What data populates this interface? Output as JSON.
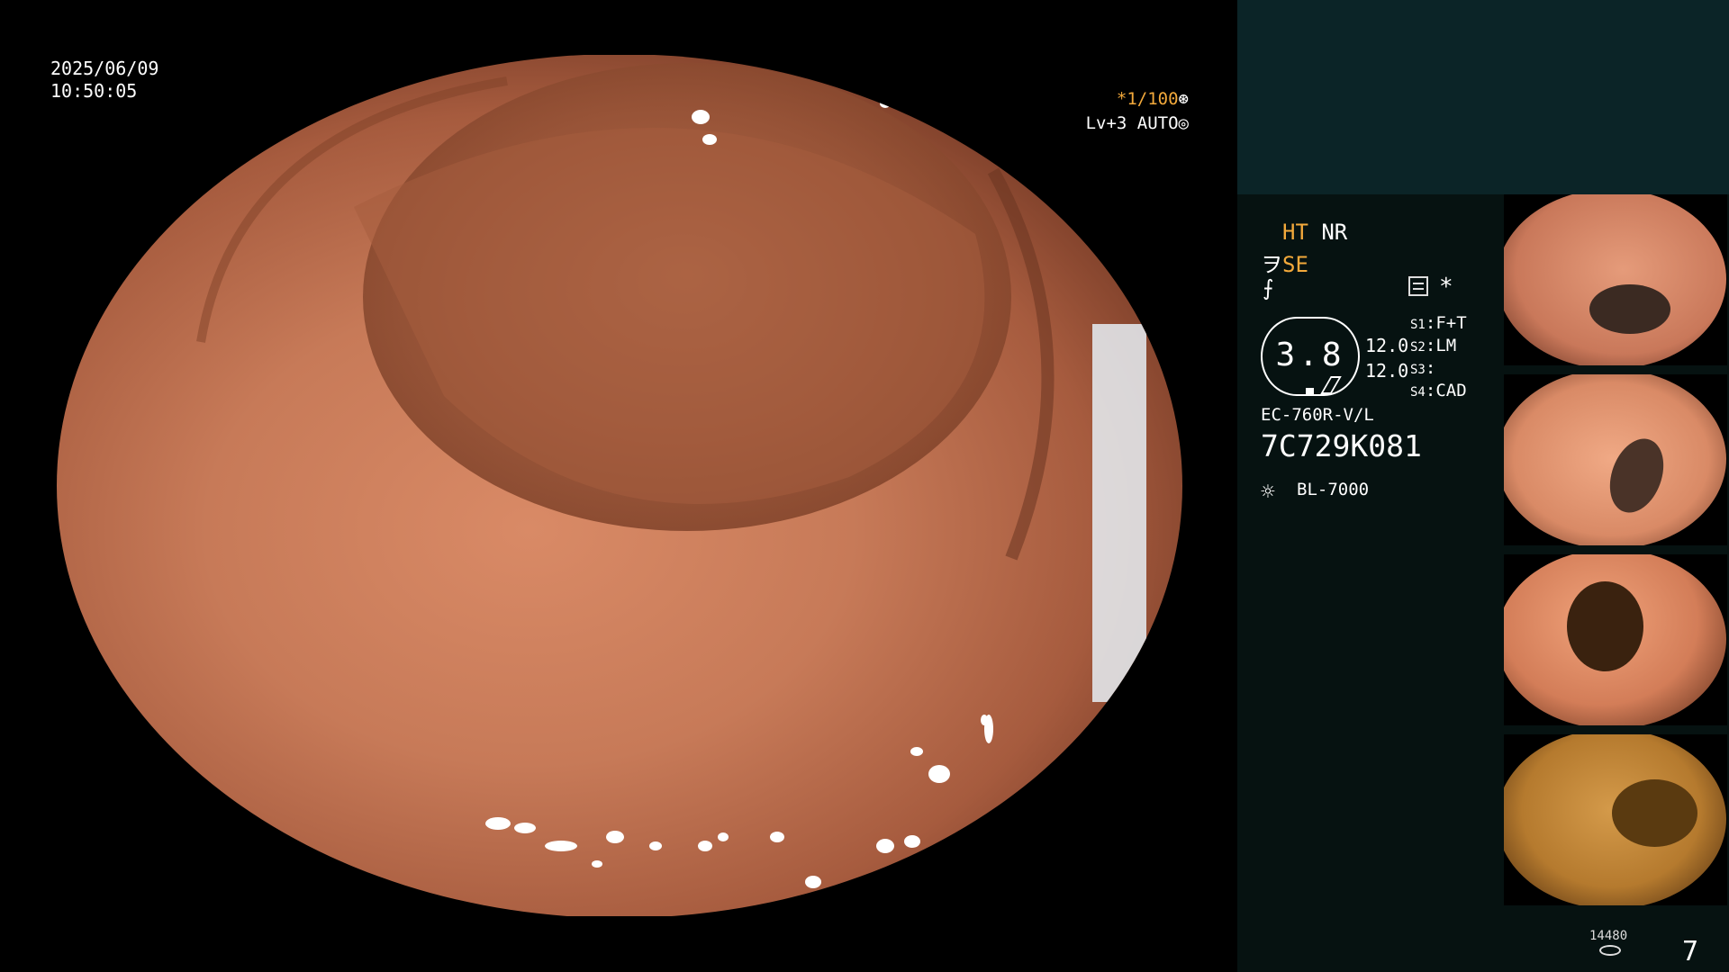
{
  "datetime": {
    "date": "2025/06/09",
    "time": "10:50:05"
  },
  "osd": {
    "shutter": "*1/100",
    "shutter_icon": "aperture-icon",
    "level": "Lv+3 AUTO",
    "level_icon": "iris-icon"
  },
  "panel": {
    "ht": "HT",
    "nr": "NR",
    "se": "SE",
    "se_icon": "enhancement-icon",
    "filter_icon": "filter-icon",
    "mode_icon": "menu-icon",
    "star": "*",
    "zoom": {
      "value": "3.8",
      "a": "12.0",
      "b": "12.0"
    },
    "slots": [
      {
        "key": "S1",
        "value": "F+T"
      },
      {
        "key": "S2",
        "value": "LM"
      },
      {
        "key": "S3",
        "value": ""
      },
      {
        "key": "S4",
        "value": "CAD"
      }
    ],
    "scope_model": "EC-760R-V/L",
    "scope_serial": "7C729K081",
    "light_icon": "lamp-icon",
    "light_source": "BL-7000",
    "storage_count": "14480",
    "storage_icon": "disk-icon",
    "capture_count": "7"
  },
  "colors": {
    "accent": "#f3a93b",
    "panel_top": "#0b2427",
    "panel_body": "#061211"
  }
}
